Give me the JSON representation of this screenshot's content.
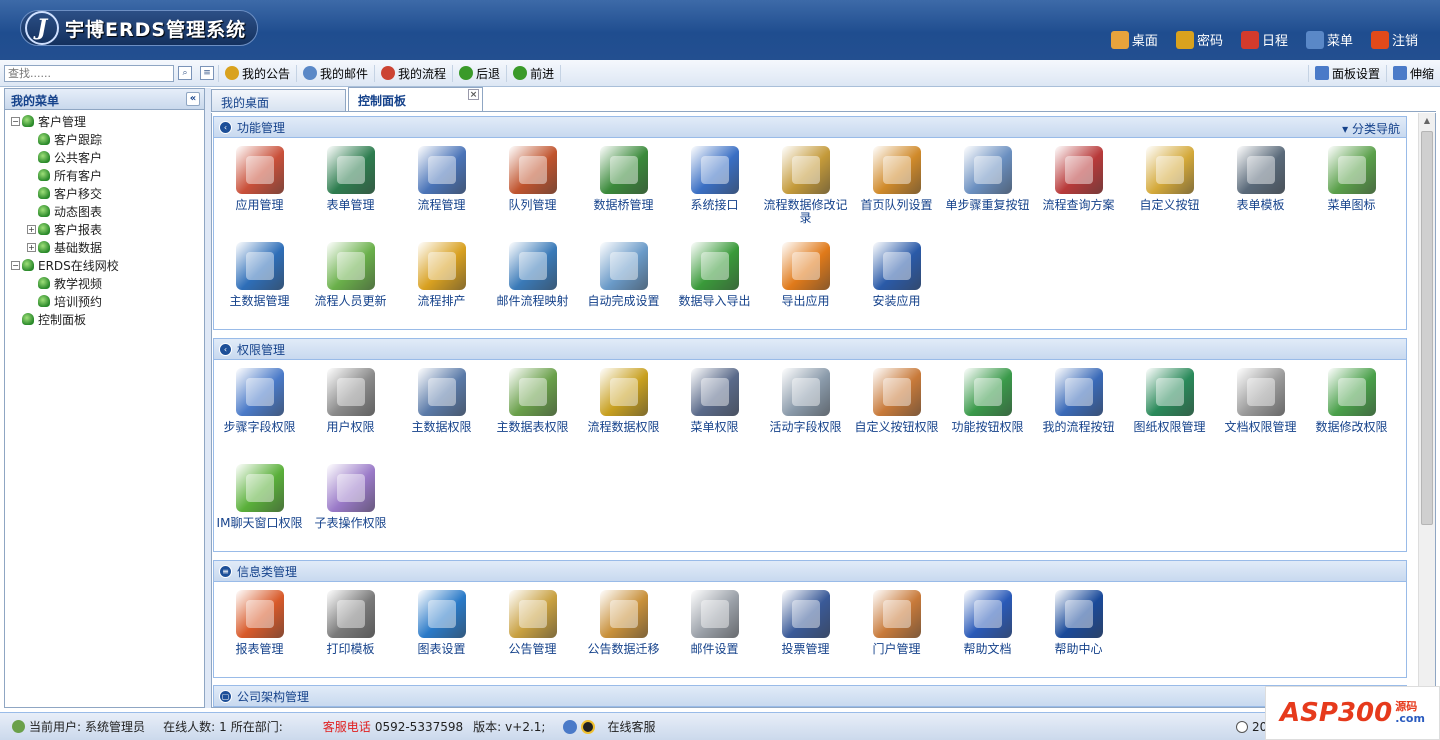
{
  "app": {
    "title": "宇博ERDS管理系统",
    "logo_letter": "J"
  },
  "topnav": [
    {
      "label": "桌面",
      "icon": "home-icon",
      "color": "#e8a33c"
    },
    {
      "label": "密码",
      "icon": "lock-icon",
      "color": "#d9a21e"
    },
    {
      "label": "日程",
      "icon": "calendar-icon",
      "color": "#d33b2c"
    },
    {
      "label": "菜单",
      "icon": "menu-icon",
      "color": "#5a88c7"
    },
    {
      "label": "注销",
      "icon": "power-icon",
      "color": "#e04a1a"
    }
  ],
  "toolbar": {
    "search_placeholder": "查找......",
    "buttons": [
      {
        "label": "我的公告",
        "icon": "announcement-icon",
        "color": "#d9a21e"
      },
      {
        "label": "我的邮件",
        "icon": "mail-icon",
        "color": "#5a88c7"
      },
      {
        "label": "我的流程",
        "icon": "flow-icon",
        "color": "#c43"
      },
      {
        "label": "后退",
        "icon": "back-icon",
        "color": "#3a9a2a"
      },
      {
        "label": "前进",
        "icon": "forward-icon",
        "color": "#3a9a2a"
      }
    ],
    "right": [
      {
        "label": "面板设置",
        "icon": "panel-settings-icon"
      },
      {
        "label": "伸缩",
        "icon": "expand-icon"
      }
    ]
  },
  "sidebar": {
    "title": "我的菜单",
    "tree": [
      {
        "label": "客户管理",
        "level": 0,
        "expander": "-"
      },
      {
        "label": "客户跟踪",
        "level": 1
      },
      {
        "label": "公共客户",
        "level": 1
      },
      {
        "label": "所有客户",
        "level": 1
      },
      {
        "label": "客户移交",
        "level": 1
      },
      {
        "label": "动态图表",
        "level": 1
      },
      {
        "label": "客户报表",
        "level": 1,
        "expander": "+"
      },
      {
        "label": "基础数据",
        "level": 1,
        "expander": "+"
      },
      {
        "label": "ERDS在线网校",
        "level": 0,
        "expander": "-"
      },
      {
        "label": "教学视频",
        "level": 1
      },
      {
        "label": "培训预约",
        "level": 1
      },
      {
        "label": "控制面板",
        "level": 0
      }
    ]
  },
  "tabs": [
    {
      "label": "我的桌面",
      "active": false
    },
    {
      "label": "控制面板",
      "active": true
    }
  ],
  "panels": [
    {
      "title": "功能管理",
      "nav_label": "▾ 分类导航",
      "items": [
        {
          "label": "应用管理",
          "color": "#c9503a"
        },
        {
          "label": "表单管理",
          "color": "#2e7d4f"
        },
        {
          "label": "流程管理",
          "color": "#4a74b8"
        },
        {
          "label": "队列管理",
          "color": "#c0542e"
        },
        {
          "label": "数据桥管理",
          "color": "#3a8a3a"
        },
        {
          "label": "系统接口",
          "color": "#3a6fc4"
        },
        {
          "label": "流程数据修改记录",
          "color": "#c49a3a"
        },
        {
          "label": "首页队列设置",
          "color": "#d08a2a"
        },
        {
          "label": "单步骤重复按钮",
          "color": "#6a8fc0"
        },
        {
          "label": "流程查询方案",
          "color": "#b83a3a"
        },
        {
          "label": "自定义按钮",
          "color": "#d4a93a"
        },
        {
          "label": "表单模板",
          "color": "#5a6a7a"
        },
        {
          "label": "菜单图标",
          "color": "#5aa04a"
        },
        {
          "label": "主数据管理",
          "color": "#2e6eb8"
        },
        {
          "label": "流程人员更新",
          "color": "#6ab04a"
        },
        {
          "label": "流程排产",
          "color": "#d8a020"
        },
        {
          "label": "邮件流程映射",
          "color": "#3a7ab8"
        },
        {
          "label": "自动完成设置",
          "color": "#6a9ac8"
        },
        {
          "label": "数据导入导出",
          "color": "#3a9a3a"
        },
        {
          "label": "导出应用",
          "color": "#e07a1a"
        },
        {
          "label": "安装应用",
          "color": "#2a5aa8"
        }
      ]
    },
    {
      "title": "权限管理",
      "items": [
        {
          "label": "步骤字段权限",
          "color": "#4a7ac8"
        },
        {
          "label": "用户权限",
          "color": "#8a8a8a"
        },
        {
          "label": "主数据权限",
          "color": "#5a7aa8"
        },
        {
          "label": "主数据表权限",
          "color": "#6aa04a"
        },
        {
          "label": "流程数据权限",
          "color": "#c8a020"
        },
        {
          "label": "菜单权限",
          "color": "#5a6a8a"
        },
        {
          "label": "活动字段权限",
          "color": "#8a9aaa"
        },
        {
          "label": "自定义按钮权限",
          "color": "#c87a3a"
        },
        {
          "label": "功能按钮权限",
          "color": "#3a9a4a"
        },
        {
          "label": "我的流程按钮",
          "color": "#3a6ab8"
        },
        {
          "label": "图纸权限管理",
          "color": "#2a8a5a"
        },
        {
          "label": "文档权限管理",
          "color": "#9a9a9a"
        },
        {
          "label": "数据修改权限",
          "color": "#4aa04a"
        },
        {
          "label": "IM聊天窗口权限",
          "color": "#5ab03a"
        },
        {
          "label": "子表操作权限",
          "color": "#9a7ac8"
        }
      ]
    },
    {
      "title": "信息类管理",
      "items": [
        {
          "label": "报表管理",
          "color": "#d85a2a"
        },
        {
          "label": "打印模板",
          "color": "#7a7a7a"
        },
        {
          "label": "图表设置",
          "color": "#2a7ac8"
        },
        {
          "label": "公告管理",
          "color": "#c8a040"
        },
        {
          "label": "公告数据迁移",
          "color": "#c8903a"
        },
        {
          "label": "邮件设置",
          "color": "#9aa0a8"
        },
        {
          "label": "投票管理",
          "color": "#3a5a98"
        },
        {
          "label": "门户管理",
          "color": "#c87a3a"
        },
        {
          "label": "帮助文档",
          "color": "#2a5ab8"
        },
        {
          "label": "帮助中心",
          "color": "#1a4a9a"
        }
      ]
    },
    {
      "title": "公司架构管理",
      "items": []
    }
  ],
  "statusbar": {
    "current_user_label": "当前用户:",
    "current_user": "系统管理员",
    "online_label": "在线人数:",
    "online_count": "1",
    "dept_label": "所在部门:",
    "hotline_label": "客服电话",
    "hotline": "0592-5337598",
    "version_label": "版本:",
    "version": "v+2.1;",
    "service": "在线客服",
    "date_partial": "20"
  },
  "watermark": {
    "brand": "ASP300",
    "suffix": "源码",
    "domain": ".com"
  }
}
